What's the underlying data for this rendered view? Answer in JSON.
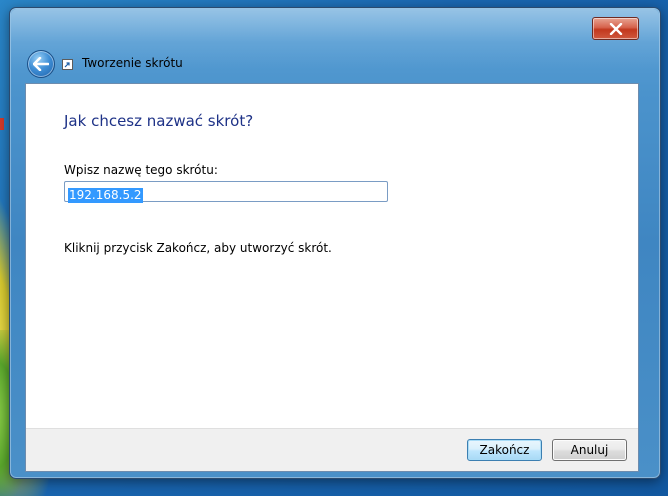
{
  "window": {
    "title": "Tworzenie skrótu"
  },
  "main": {
    "heading": "Jak chcesz nazwać skrót?",
    "name_label": "Wpisz nazwę tego skrótu:",
    "name_value": "192.168.5.2",
    "instruction": "Kliknij przycisk Zakończ, aby utworzyć skrót."
  },
  "footer": {
    "finish_label": "Zakończ",
    "cancel_label": "Anuluj"
  },
  "icons": {
    "back": "back-arrow-icon",
    "close": "close-icon",
    "shortcut": "shortcut-icon"
  },
  "colors": {
    "heading": "#1e3287",
    "selection": "#3399ff",
    "close_button": "#c2381e",
    "glass": "#4b93cc"
  }
}
